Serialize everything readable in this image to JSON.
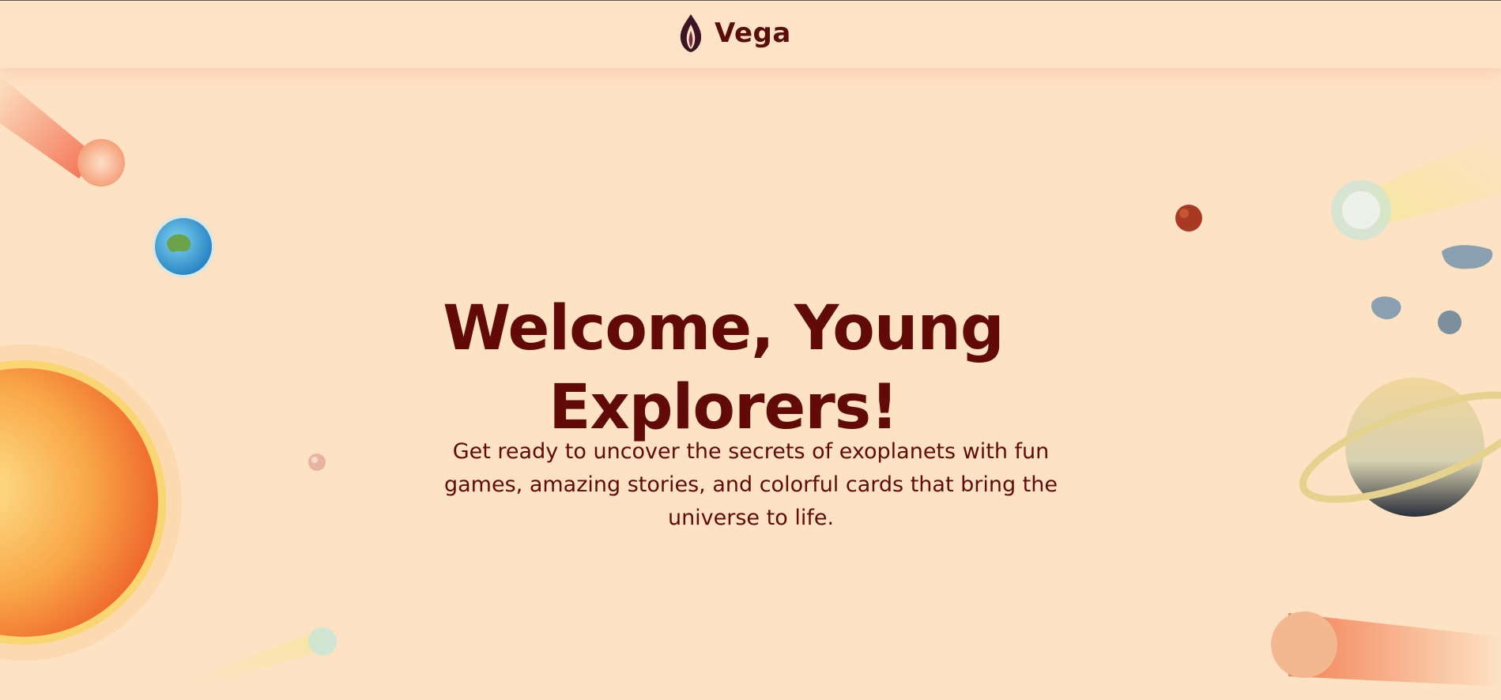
{
  "header": {
    "brand_name": "Vega",
    "logo_icon": "flame-logo-icon"
  },
  "hero": {
    "title": "Welcome, Young Explorers!",
    "description": "Get ready to uncover the secrets of exoplanets with fun games, amazing stories, and colorful cards that bring the universe to life."
  },
  "decorations": [
    "comet-icon",
    "earth-icon",
    "sun-icon",
    "mars-icon",
    "asteroid-icon",
    "saturn-icon",
    "moon-icon"
  ],
  "colors": {
    "background": "#fde2c4",
    "text": "#620a08",
    "brand": "#5a0e0c"
  }
}
